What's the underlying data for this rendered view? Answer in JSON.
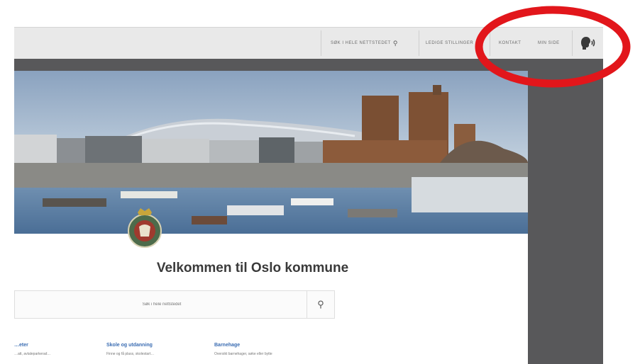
{
  "topbar": {
    "search_site_label": "SØK I HELE NETTSTEDET",
    "jobs_label": "LEDIGE STILLINGER",
    "contact_label": "KONTAKT",
    "mypage_label": "MIN SIDE",
    "icons": [
      "search-icon",
      "speaker-icon"
    ]
  },
  "main": {
    "welcome_title": "Velkommen til Oslo kommune",
    "search_placeholder": "Søk i hele nettstedet"
  },
  "links": [
    {
      "title": "…eter",
      "desc": "…att, avtaleparkerad…"
    },
    {
      "title": "Skole og utdanning",
      "desc": "Finne og få plass, skolestart…"
    },
    {
      "title": "Barnehage",
      "desc": "Oversikt barnehager, søke eller bytte"
    }
  ],
  "colors": {
    "annotation_ring": "#e2161b",
    "dark_band": "#58585a",
    "link": "#3a6cb2"
  }
}
